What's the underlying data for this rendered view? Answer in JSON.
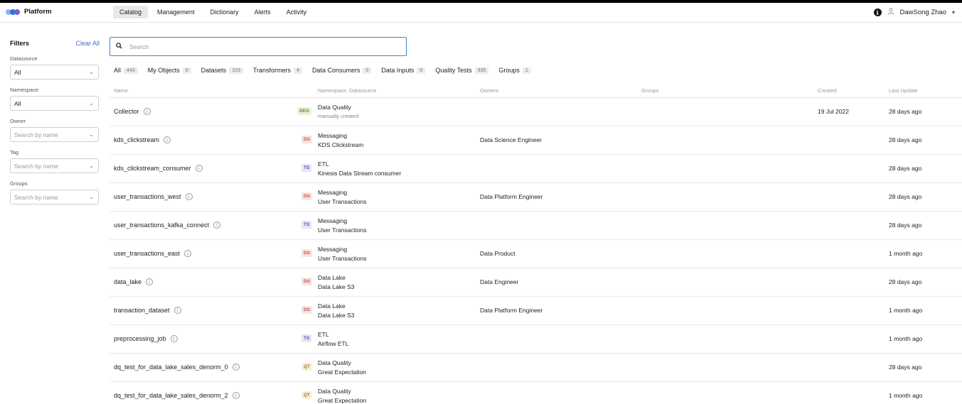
{
  "app": {
    "name": "Platform",
    "logo_colors": [
      "#5b8def",
      "#2f6fe0",
      "#7a5cd6"
    ]
  },
  "nav": {
    "items": [
      {
        "label": "Catalog",
        "active": true
      },
      {
        "label": "Management",
        "active": false
      },
      {
        "label": "Dictionary",
        "active": false
      },
      {
        "label": "Alerts",
        "active": false
      },
      {
        "label": "Activity",
        "active": false
      }
    ]
  },
  "user": {
    "name": "DawSong Zhao"
  },
  "filters": {
    "title": "Filters",
    "clear_all": "Clear All",
    "fields": [
      {
        "label": "Datasource",
        "value": "All",
        "is_placeholder": false
      },
      {
        "label": "Namespace",
        "value": "All",
        "is_placeholder": false
      },
      {
        "label": "Owner",
        "value": "Search by name",
        "is_placeholder": true
      },
      {
        "label": "Tag",
        "value": "Search by name",
        "is_placeholder": true
      },
      {
        "label": "Groups",
        "value": "Search by name",
        "is_placeholder": true
      }
    ]
  },
  "search": {
    "placeholder": "Search",
    "value": "",
    "accent": "#4a7fd0"
  },
  "tabs": [
    {
      "label": "All",
      "count": "443"
    },
    {
      "label": "My Objects",
      "count": "0"
    },
    {
      "label": "Datasets",
      "count": "103"
    },
    {
      "label": "Transformers",
      "count": "4"
    },
    {
      "label": "Data Consumers",
      "count": "0"
    },
    {
      "label": "Data Inputs",
      "count": "0"
    },
    {
      "label": "Quality Tests",
      "count": "335"
    },
    {
      "label": "Groups",
      "count": "1"
    }
  ],
  "table": {
    "columns": [
      "Name",
      "Namespace, Datasource",
      "Owners",
      "Groups",
      "Created",
      "Last Update"
    ],
    "badge_styles": {
      "DEG": {
        "bg": "#e6f4dc",
        "fg": "#5b8a3a"
      },
      "DS": {
        "bg": "#fbe3e3",
        "fg": "#c0504d"
      },
      "TS": {
        "bg": "#e4e6f8",
        "fg": "#4b55a8"
      },
      "QT": {
        "bg": "#fbf1d9",
        "fg": "#9a7a2a"
      }
    },
    "rows": [
      {
        "name": "Collector",
        "badge": "DEG",
        "ns": "Data Quality",
        "ds": "manually created",
        "ds_muted": true,
        "owner": "",
        "created": "19 Jul 2022",
        "updated": "28 days ago"
      },
      {
        "name": "kds_clickstream",
        "badge": "DS",
        "ns": "Messaging",
        "ds": "KDS Clickstream",
        "ds_muted": false,
        "owner": "Data Science Engineer",
        "created": "",
        "updated": "28 days ago"
      },
      {
        "name": "kds_clickstream_consumer",
        "badge": "TS",
        "ns": "ETL",
        "ds": "Kinesis Data Stream consumer",
        "ds_muted": false,
        "owner": "",
        "created": "",
        "updated": "28 days ago"
      },
      {
        "name": "user_transactions_west",
        "badge": "DS",
        "ns": "Messaging",
        "ds": "User Transactions",
        "ds_muted": false,
        "owner": "Data Platform Engineer",
        "created": "",
        "updated": "28 days ago"
      },
      {
        "name": "user_transactions_kafka_connect",
        "badge": "TS",
        "ns": "Messaging",
        "ds": "User Transactions",
        "ds_muted": false,
        "owner": "",
        "created": "",
        "updated": "28 days ago"
      },
      {
        "name": "user_transactions_east",
        "badge": "DS",
        "ns": "Messaging",
        "ds": "User Transactions",
        "ds_muted": false,
        "owner": "Data Product",
        "created": "",
        "updated": "1 month ago"
      },
      {
        "name": "data_lake",
        "badge": "DS",
        "ns": "Data Lake",
        "ds": "Data Lake S3",
        "ds_muted": false,
        "owner": "Data Engineer",
        "created": "",
        "updated": "28 days ago"
      },
      {
        "name": "transaction_dataset",
        "badge": "DS",
        "ns": "Data Lake",
        "ds": "Data Lake S3",
        "ds_muted": false,
        "owner": "Data Platform Engineer",
        "created": "",
        "updated": "1 month ago"
      },
      {
        "name": "preprocessing_job",
        "badge": "TS",
        "ns": "ETL",
        "ds": "Airflow ETL",
        "ds_muted": false,
        "owner": "",
        "created": "",
        "updated": "1 month ago"
      },
      {
        "name": "dq_test_for_data_lake_sales_denorm_0",
        "badge": "QT",
        "ns": "Data Quality",
        "ds": "Great Expectation",
        "ds_muted": false,
        "owner": "",
        "created": "",
        "updated": "28 days ago"
      },
      {
        "name": "dq_test_for_data_lake_sales_denorm_2",
        "badge": "QT",
        "ns": "Data Quality",
        "ds": "Great Expectation",
        "ds_muted": false,
        "owner": "",
        "created": "",
        "updated": "1 month ago"
      }
    ]
  }
}
